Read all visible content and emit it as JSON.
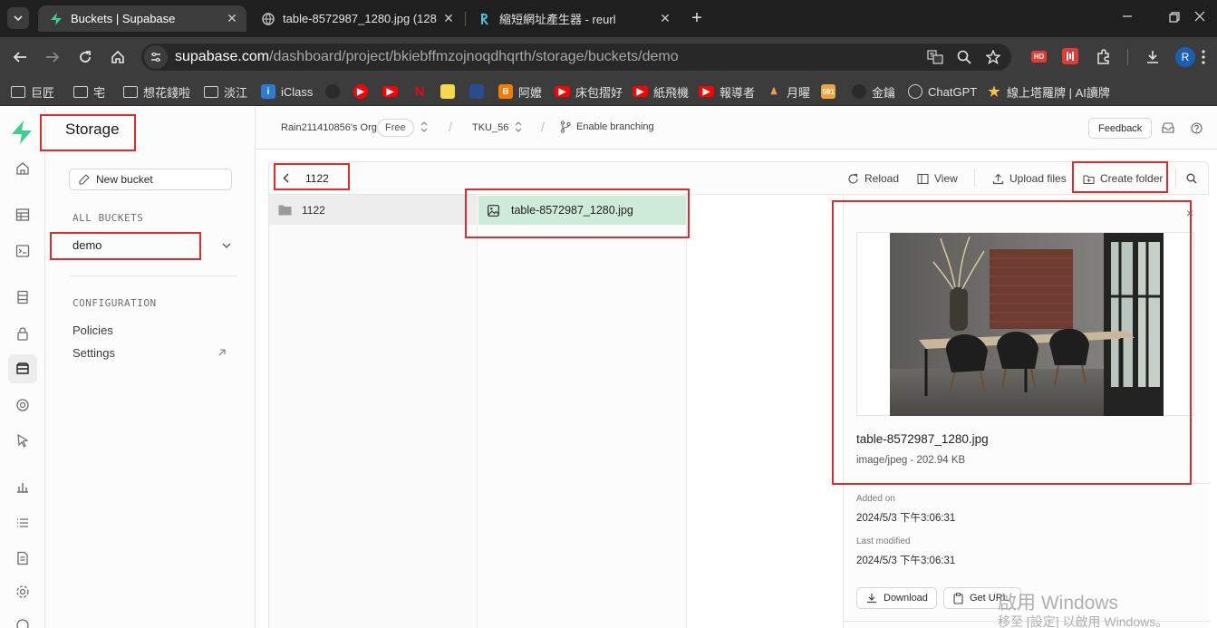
{
  "browser": {
    "tabs": [
      {
        "title": "Buckets | Supabase",
        "active": true
      },
      {
        "title": "table-8572987_1280.jpg (128",
        "active": false
      },
      {
        "title": "縮短網址產生器 - reurl",
        "active": false
      }
    ],
    "url_host": "supabase.com",
    "url_path": "/dashboard/project/bkiebffmzojnoqdhqrth/storage/buckets/demo",
    "avatar_letter": "R",
    "hd_badge": "HD",
    "bookmarks": [
      {
        "label": "巨匠",
        "icon": "folder-icon"
      },
      {
        "label": "宅",
        "icon": "folder-icon"
      },
      {
        "label": "想花錢啦",
        "icon": "folder-icon"
      },
      {
        "label": "淡江",
        "icon": "folder-icon"
      },
      {
        "label": "iClass",
        "icon": "iclass-icon"
      },
      {
        "label": "",
        "icon": "github-icon"
      },
      {
        "label": "",
        "icon": "youtube-music-icon"
      },
      {
        "label": "",
        "icon": "youtube-icon"
      },
      {
        "label": "",
        "icon": "netflix-icon"
      },
      {
        "label": "",
        "icon": "lemon-icon"
      },
      {
        "label": "",
        "icon": "game-icon"
      },
      {
        "label": "阿嬤",
        "icon": "blogger-icon"
      },
      {
        "label": "床包摺好",
        "icon": "youtube-icon"
      },
      {
        "label": "紙飛機",
        "icon": "youtube-icon"
      },
      {
        "label": "報導者",
        "icon": "youtube-icon"
      },
      {
        "label": "月曜",
        "icon": "figure-icon"
      },
      {
        "label": "",
        "icon": "591-icon"
      },
      {
        "label": "金鑰",
        "icon": "github-icon"
      },
      {
        "label": "ChatGPT",
        "icon": "chatgpt-icon"
      },
      {
        "label": "線上塔羅牌 | AI讀牌",
        "icon": "star-icon"
      }
    ],
    "bm_591": "591"
  },
  "app": {
    "section_title": "Storage",
    "new_bucket_label": "New bucket",
    "all_buckets_heading": "ALL BUCKETS",
    "bucket_name": "demo",
    "configuration_heading": "CONFIGURATION",
    "policies_label": "Policies",
    "settings_label": "Settings",
    "org_name": "Rain211410856's Org",
    "plan_badge": "Free",
    "project_name": "TKU_56",
    "branching_label": "Enable branching",
    "feedback_label": "Feedback",
    "breadcrumb_folder": "1122",
    "reload_label": "Reload",
    "view_label": "View",
    "upload_label": "Upload files",
    "create_folder_label": "Create folder",
    "folder_item": "1122",
    "file_item": "table-8572987_1280.jpg",
    "preview": {
      "file_name": "table-8572987_1280.jpg",
      "file_meta": "image/jpeg - 202.94 KB",
      "added_on_label": "Added on",
      "added_on_value": "2024/5/3 下午3:06:31",
      "last_modified_label": "Last modified",
      "last_modified_value": "2024/5/3 下午3:06:31",
      "download_label": "Download",
      "get_url_label": "Get URL",
      "close_glyph": "×"
    }
  },
  "watermark": {
    "line1": "啟用 Windows",
    "line2": "移至 [設定] 以啟用 Windows。"
  },
  "colors": {
    "supabase_green": "#3ecf8e",
    "selection_green": "#cdebd8",
    "annotation_red": "#e02b2b"
  }
}
